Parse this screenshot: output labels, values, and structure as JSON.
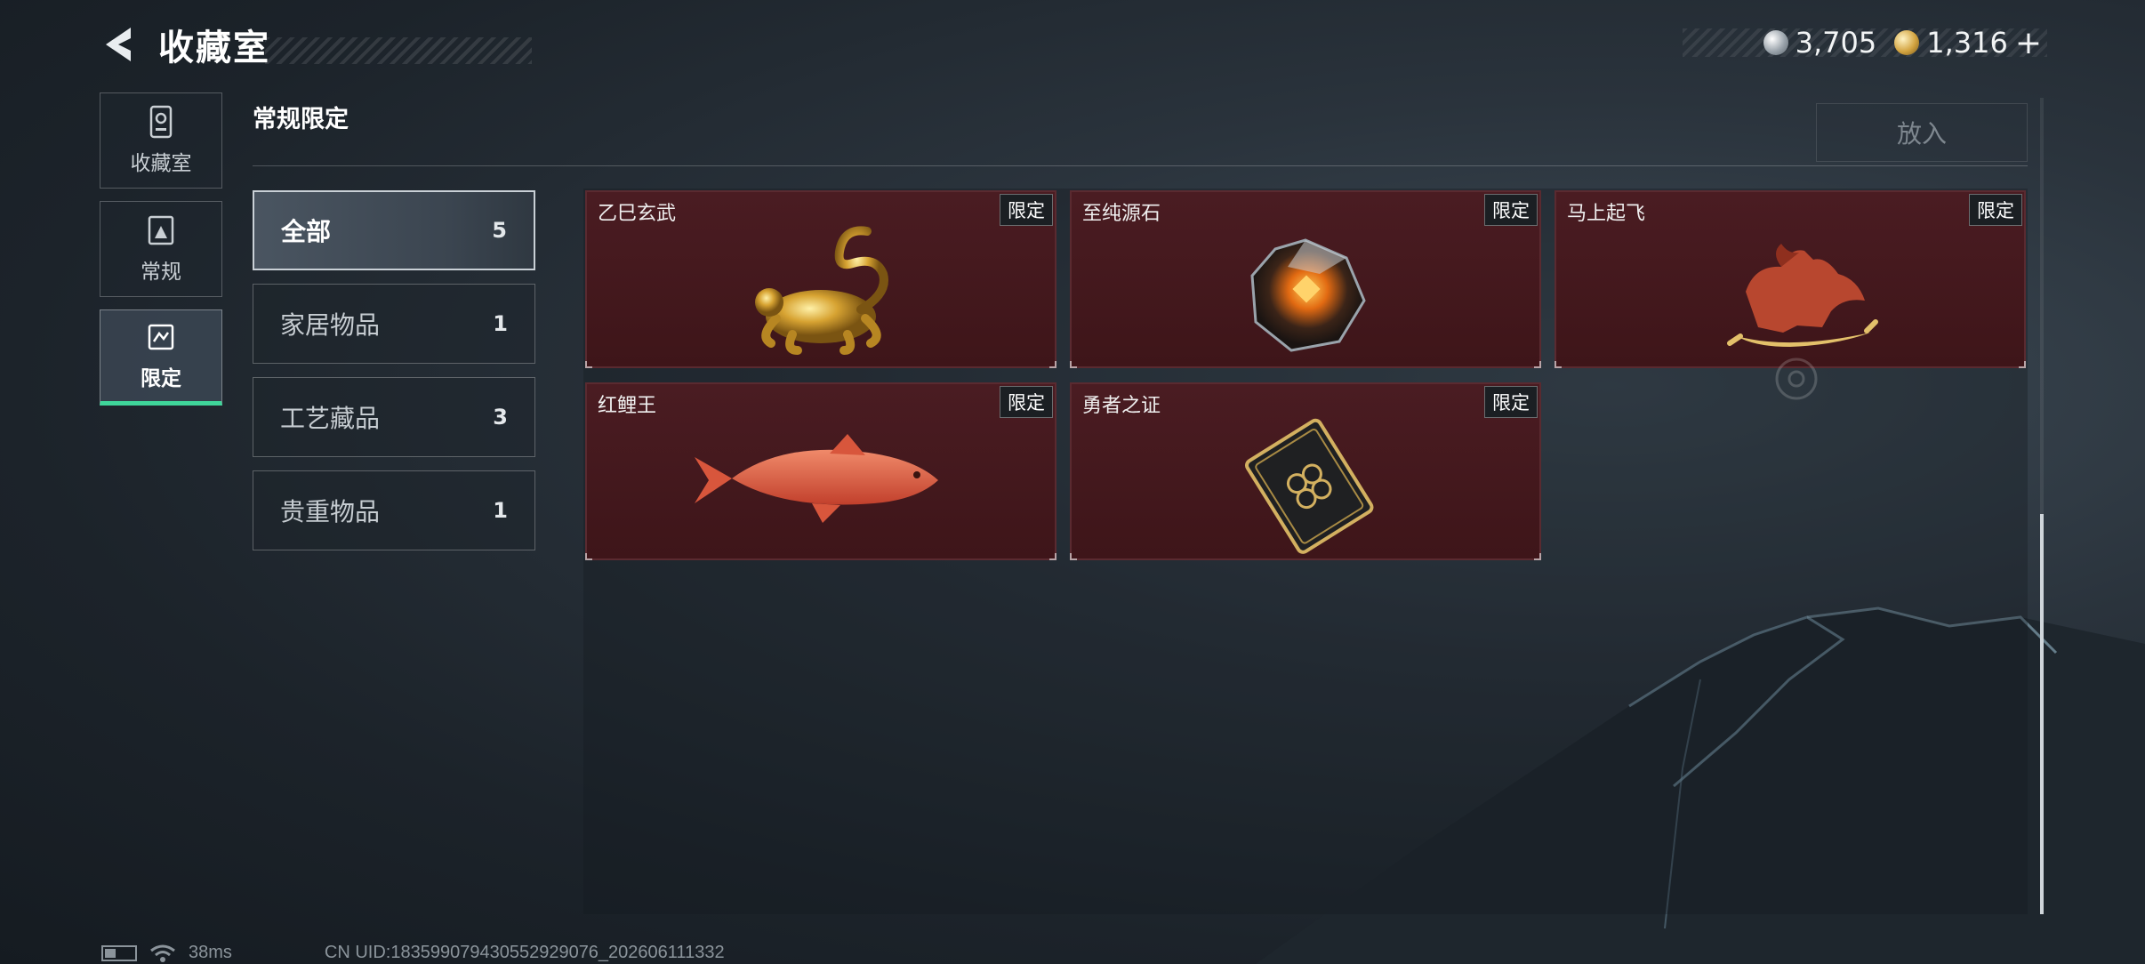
{
  "header": {
    "title": "收藏室"
  },
  "currency": [
    {
      "icon": "silver-coin-icon",
      "value": "3,705"
    },
    {
      "icon": "gold-coin-icon",
      "value": "1,316"
    }
  ],
  "currency_add": "+",
  "leftnav": [
    {
      "label": "收藏室",
      "icon": "collection-icon",
      "active": false
    },
    {
      "label": "常规",
      "icon": "regular-icon",
      "active": false
    },
    {
      "label": "限定",
      "icon": "limited-icon",
      "active": true
    }
  ],
  "section": {
    "title": "常规限定",
    "put_label": "放入"
  },
  "categories": [
    {
      "label": "全部",
      "count": "5",
      "active": true
    },
    {
      "label": "家居物品",
      "count": "1",
      "active": false
    },
    {
      "label": "工艺藏品",
      "count": "3",
      "active": false
    },
    {
      "label": "贵重物品",
      "count": "1",
      "active": false
    }
  ],
  "items": [
    {
      "name": "乙巳玄武",
      "badge": "限定",
      "icon": "golden-serpent-tortoise-icon"
    },
    {
      "name": "至纯源石",
      "badge": "限定",
      "icon": "faceted-gem-icon"
    },
    {
      "name": "马上起飞",
      "badge": "限定",
      "icon": "red-horse-statue-icon"
    },
    {
      "name": "红鲤王",
      "badge": "限定",
      "icon": "red-carp-icon"
    },
    {
      "name": "勇者之证",
      "badge": "限定",
      "icon": "ornate-card-icon"
    }
  ],
  "footer": {
    "latency": "38ms",
    "uid": "CN UID:1835990794305529​29076_202606111332"
  },
  "colors": {
    "accent": "#3fd59a",
    "card_bg": "#4a1c22"
  }
}
